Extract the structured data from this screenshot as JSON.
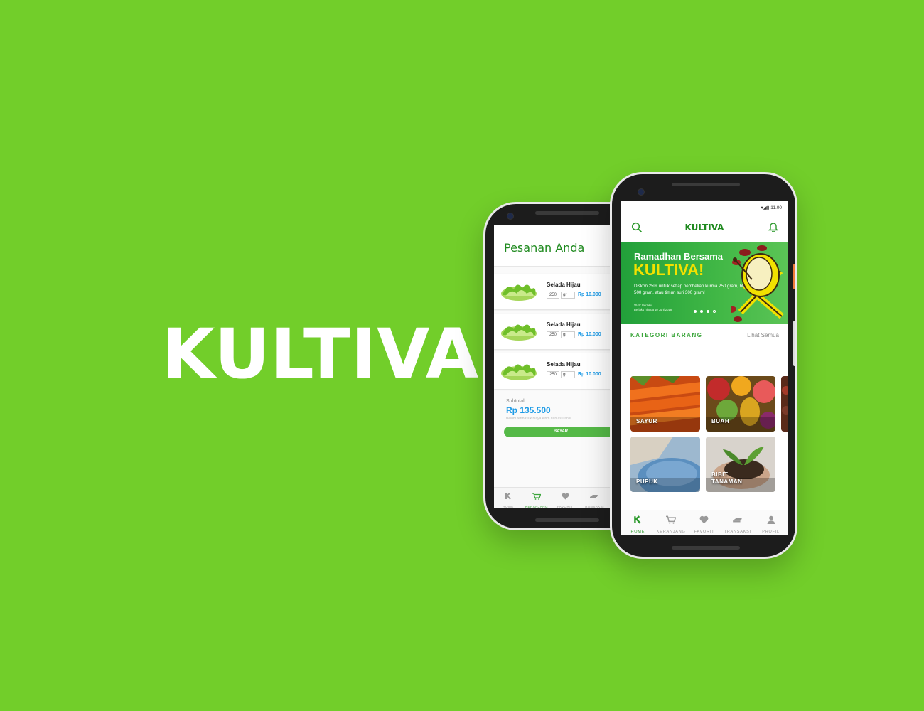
{
  "brand": {
    "name": "KULTIVA"
  },
  "colors": {
    "background": "#72CE2A",
    "brand_green": "#1f8a1f",
    "price_blue": "#1e9be6",
    "banner_yellow": "#f2e100"
  },
  "cart_screen": {
    "title": "Pesanan Anda",
    "items": [
      {
        "name": "Selada Hijau",
        "qty": "250",
        "unit": "gr",
        "price": "Rp 10.000"
      },
      {
        "name": "Selada Hijau",
        "qty": "250",
        "unit": "gr",
        "price": "Rp 10.000"
      },
      {
        "name": "Selada Hijau",
        "qty": "250",
        "unit": "gr",
        "price": "Rp 10.000"
      }
    ],
    "subtotal_label": "Subtotal",
    "subtotal_value": "Rp 135.500",
    "subtotal_note": "Belum termasuk biaya kirim dan asuransi",
    "pay_button": "BAYAR",
    "nav": [
      {
        "label": "HOME",
        "icon": "k-logo-icon",
        "active": false
      },
      {
        "label": "KERANJANG",
        "icon": "cart-icon",
        "active": true
      },
      {
        "label": "FAVORIT",
        "icon": "heart-icon",
        "active": false
      },
      {
        "label": "TRANSAKSI",
        "icon": "transaction-icon",
        "active": false
      }
    ]
  },
  "home_screen": {
    "status_time": "11.00",
    "app_title": "KULTIVA",
    "banner": {
      "line1": "Ramadhan Bersama",
      "line2": "KULTIVA!",
      "description": "Diskon 25% untuk setiap pembelian kurma 250 gram, blewah 500 gram, atau timun suri 300 gram!",
      "terms_line1": "*S&K Berlaku",
      "terms_line2": "Berlaku hingga 10 Juni 2018"
    },
    "section_title": "KATEGORI BARANG",
    "see_all": "Lihat Semua",
    "categories": [
      {
        "label": "SAYUR",
        "icon": "carrots-photo"
      },
      {
        "label": "BUAH",
        "icon": "fruits-photo"
      },
      {
        "label": "PUPUK",
        "icon": "fertilizer-photo"
      },
      {
        "label": "BIBIT TANAMAN",
        "label_line1": "BIBIT",
        "label_line2": "TANAMAN",
        "icon": "seedling-photo"
      }
    ],
    "nav": [
      {
        "label": "HOME",
        "icon": "k-logo-icon",
        "active": true
      },
      {
        "label": "KERANJANG",
        "icon": "cart-icon",
        "active": false
      },
      {
        "label": "FAVORIT",
        "icon": "heart-icon",
        "active": false
      },
      {
        "label": "TRANSAKSI",
        "icon": "transaction-icon",
        "active": false
      },
      {
        "label": "PROFIL",
        "icon": "profile-icon",
        "active": false
      }
    ]
  }
}
